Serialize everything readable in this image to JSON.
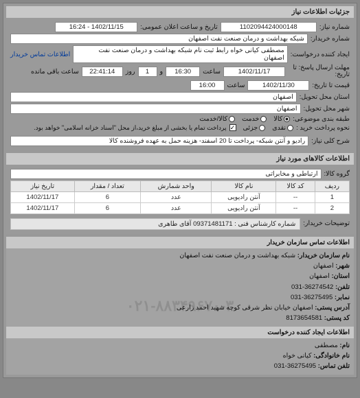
{
  "headerTitle": "جزئیات اطلاعات نیاز",
  "info": {
    "reqNoLabel": "شماره نیاز:",
    "reqNo": "1102094424000148",
    "pubDateLabel": "تاریخ و ساعت اعلان عمومی:",
    "pubDate": "1402/11/15 - 16:24",
    "buyerNameLabel": "شماره خریدار:",
    "buyerName": "شبکه بهداشت و درمان صنعت نفت اصفهان",
    "creatorLabel": "ایجاد کننده درخواست:",
    "creator": "مصطفی کیانی خواه رابط ثبت نام شبکه بهداشت و درمان صنعت نفت اصفهان",
    "buyerContactLink": "اطلاعات تماس خریدار",
    "deadlineLabel": "مهلت ارسال پاسخ: تا تاریخ:",
    "deadlineDate": "1402/11/17",
    "timeLabel": "ساعت",
    "deadlineTime": "16:30",
    "andLabel": "و",
    "remainDays": "1",
    "dayLabel": "روز",
    "remainTime": "22:41:14",
    "remainSuffix": "ساعت باقی مانده",
    "validLabel": "قیمت تا تاریخ:",
    "validDate": "1402/11/30",
    "validTime": "16:00",
    "delivProvLabel": "استان محل تحویل:",
    "delivProv": "اصفهان",
    "delivCityLabel": "شهر محل تحویل:",
    "delivCity": "اصفهان",
    "packLabel": "طبقه بندی موضوعی:",
    "radioGoods": "کالا",
    "radioService": "کالا/خدمت",
    "radioServiceOnly": "خدمت",
    "paymentLabel": "نحوه پرداخت خرید :",
    "payCash": "نقدی",
    "payPartial": "جزئی",
    "payNote": "پرداخت تمام یا بخشی از مبلغ خرید،از محل \"اسناد خزانه اسلامی\" خواهد بود.",
    "subjectLabel": "شرح کلی نیاز:",
    "subject": "رادیو و آنتن شبکه- پرداخت تا 20 اسفند- هزینه حمل به عهده فروشنده کالا"
  },
  "itemsTitle": "اطلاعات کالاهای مورد نیاز",
  "groupLabel": "گروه کالا:",
  "groupValue": "ارتباطی و مخابراتی",
  "columns": {
    "row": "ردیف",
    "code": "کد کالا",
    "name": "نام کالا",
    "unit": "واحد شمارش",
    "qty": "تعداد / مقدار",
    "date": "تاریخ نیاز"
  },
  "rows": [
    {
      "row": "1",
      "code": "--",
      "name": "آنتن رادیویی",
      "unit": "عدد",
      "qty": "6",
      "date": "1402/11/17"
    },
    {
      "row": "2",
      "code": "--",
      "name": "آنتن رادیویی",
      "unit": "عدد",
      "qty": "6",
      "date": "1402/11/17"
    }
  ],
  "buyerNoteLabel": "توضیحات خریدار:",
  "buyerNote": "شماره کارشناس فنی : 09371481171 آقای طاهری",
  "contact": {
    "title": "اطلاعات تماس سازمان خریدار",
    "orgLabel": "نام سازمان خریدار:",
    "org": "شبکه بهداشت و درمان صنعت نفت اصفهان",
    "provLabel": "شهر:",
    "prov": "اصفهان",
    "provinceLabel": "استان:",
    "province": "اصفهان",
    "telLabel": "تلفن:",
    "tel": "36274542-031",
    "faxLabel": "نمابر:",
    "fax": "36275495-031",
    "addrLabel": "آدرس پستی:",
    "addr": "اصفهان خیابان نظر شرقی کوچه شهید احمد زارعی",
    "postLabel": "کد پستی:",
    "post": "8173654581",
    "title2": "اطلاعات ایجاد کننده درخواست",
    "fnameLabel": "نام:",
    "fname": "مصطفی",
    "lnameLabel": "نام خانوادگی:",
    "lname": "کیانی خواه",
    "ctelLabel": "تلفن تماس:",
    "ctel": "36275495-031"
  },
  "watermark": "۰۲۱-۸۸۳۴۹۶۷۰-۳"
}
